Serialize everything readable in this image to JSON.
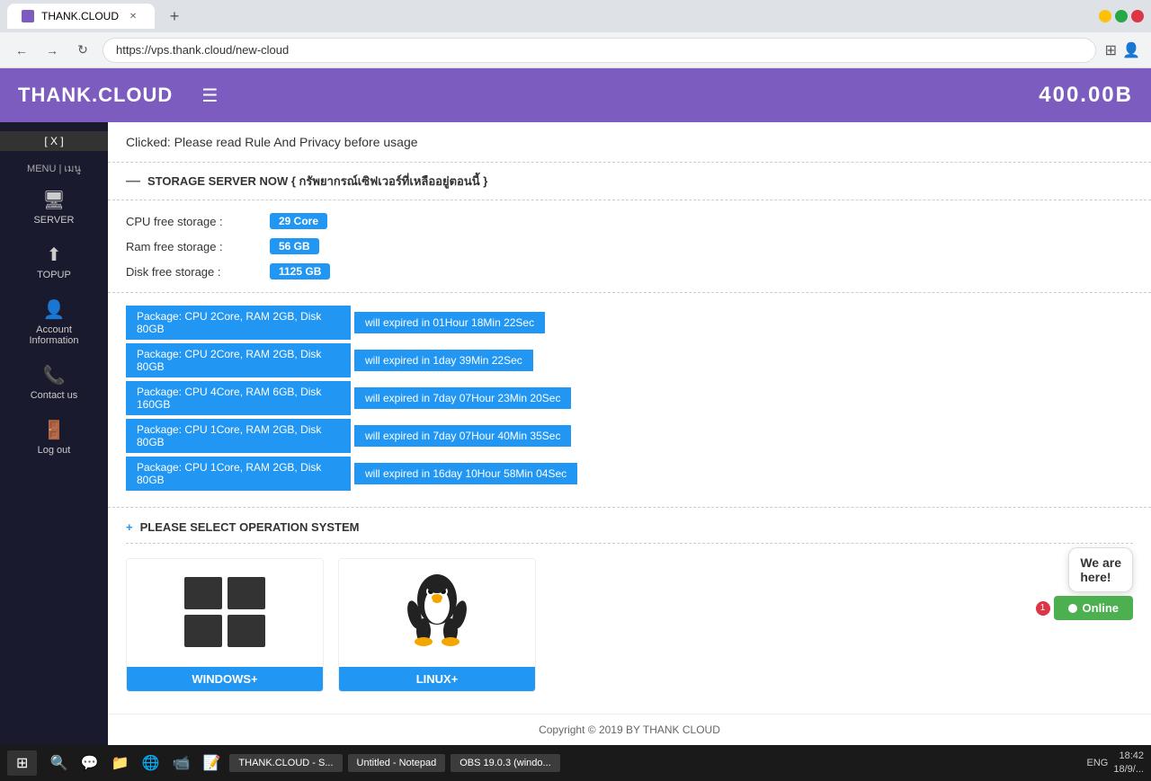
{
  "browser": {
    "tab_title": "THANK.CLOUD",
    "url": "https://vps.thank.cloud/new-cloud",
    "win_controls": [
      "minimize",
      "restore",
      "close"
    ]
  },
  "header": {
    "logo": "THANK.CLOUD",
    "balance": "400.00B",
    "menu_icon": "☰"
  },
  "sidebar": {
    "menu_label": "MENU | เมนู",
    "items": [
      {
        "icon": "🖥",
        "label": "SERVER"
      },
      {
        "icon": "⬆",
        "label": "TOPUP"
      },
      {
        "icon": "👤",
        "label": "Account\nInformation"
      },
      {
        "icon": "📞",
        "label": "Contact us"
      },
      {
        "icon": "🚪",
        "label": "Log out"
      }
    ]
  },
  "notice": {
    "text": "Clicked: Please read Rule And Privacy before usage"
  },
  "storage_section": {
    "title": "STORAGE SERVER NOW { กรัพยากรณ์เซิฟเวอร์ที่เหลืออยู่ตอนนี้ }",
    "cpu_label": "CPU free storage :",
    "cpu_value": "29 Core",
    "ram_label": "Ram free storage :",
    "ram_value": "56 GB",
    "disk_label": "Disk free storage :",
    "disk_value": "1125 GB"
  },
  "packages": [
    {
      "name": "Package: CPU 2Core, RAM 2GB, Disk 80GB",
      "expiry": "will expired in 01Hour 18Min 22Sec"
    },
    {
      "name": "Package: CPU 2Core, RAM 2GB, Disk 80GB",
      "expiry": "will expired in 1day 39Min 22Sec"
    },
    {
      "name": "Package: CPU 4Core, RAM 6GB, Disk 160GB",
      "expiry": "will expired in 7day 07Hour 23Min 20Sec"
    },
    {
      "name": "Package: CPU 1Core, RAM 2GB, Disk 80GB",
      "expiry": "will expired in 7day 07Hour 40Min 35Sec"
    },
    {
      "name": "Package: CPU 1Core, RAM 2GB, Disk 80GB",
      "expiry": "will expired in 16day 10Hour 58Min 04Sec"
    }
  ],
  "os_section": {
    "title": "PLEASE SELECT OPERATION SYSTEM",
    "options": [
      {
        "name": "WINDOWS+",
        "type": "windows"
      },
      {
        "name": "LINUX+",
        "type": "linux"
      }
    ]
  },
  "footer": {
    "text": "Copyright © 2019 BY THANK CLOUD"
  },
  "chat": {
    "bubble": "We are\nhere!",
    "online_label": "Online",
    "badge": "1"
  },
  "taskbar": {
    "time": "18:42",
    "date": "18/9/...",
    "apps": [
      "THANK.CLOUD - S...",
      "Untitled - Notepad",
      "OBS 19.0.3 (windo..."
    ]
  }
}
